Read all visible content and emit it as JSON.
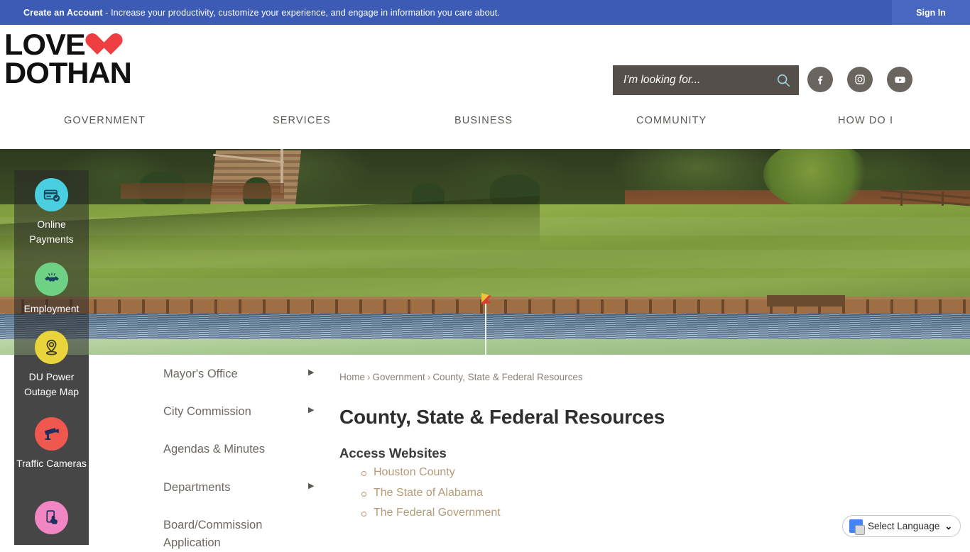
{
  "account_bar": {
    "cta": "Create an Account",
    "message": " - Increase your productivity, customize your experience, and engage in information you care about.",
    "sign_in": "Sign In",
    "bg_color": "#3b5bb5"
  },
  "header": {
    "logo_line1": "LOVE",
    "logo_line2": "DOTHAN",
    "heart_color": "#ef3e42",
    "search": {
      "placeholder": "I'm looking for...",
      "value": "",
      "bg_color": "#544f4a",
      "icon": "search-icon",
      "icon_color": "#9fd8e0"
    },
    "social": [
      {
        "name": "facebook-icon",
        "glyph": "f"
      },
      {
        "name": "instagram-icon",
        "glyph": "▣"
      },
      {
        "name": "youtube-icon",
        "glyph": "▶"
      }
    ]
  },
  "main_nav": {
    "items": [
      {
        "label": "GOVERNMENT"
      },
      {
        "label": "SERVICES"
      },
      {
        "label": "BUSINESS"
      },
      {
        "label": "COMMUNITY"
      },
      {
        "label": "HOW DO I"
      }
    ]
  },
  "quick_links": {
    "items": [
      {
        "label": "Online Payments",
        "icon": "credit-card-icon",
        "color": "#49cfe0"
      },
      {
        "label": "Employment",
        "icon": "handshake-icon",
        "color": "#6fd184"
      },
      {
        "label": "DU Power Outage Map",
        "icon": "map-pin-icon",
        "color": "#ead43c"
      },
      {
        "label": "Traffic Cameras",
        "icon": "security-camera-icon",
        "color": "#f0574f"
      },
      {
        "label": "",
        "icon": "mobile-tap-icon",
        "color": "#f286c2"
      }
    ]
  },
  "left_nav": {
    "items": [
      {
        "label": "Mayor's Office",
        "has_submenu": true
      },
      {
        "label": "City Commission",
        "has_submenu": true
      },
      {
        "label": "Agendas & Minutes",
        "has_submenu": false
      },
      {
        "label": "Departments",
        "has_submenu": true
      },
      {
        "label": "Board/Commission Application",
        "has_submenu": false
      }
    ],
    "arrow_glyph": "▶"
  },
  "main": {
    "breadcrumb": [
      "Home",
      "Government",
      "County, State & Federal Resources"
    ],
    "breadcrumb_separator": "›",
    "page_title": "County, State & Federal Resources",
    "section_heading": "Access Websites",
    "links": [
      "Houston County",
      "The State of Alabama",
      "The Federal Government"
    ],
    "link_color": "#b59b77"
  },
  "translate_widget": {
    "label": "Select Language",
    "caret": "⌄",
    "icon": "google-translate-icon"
  }
}
